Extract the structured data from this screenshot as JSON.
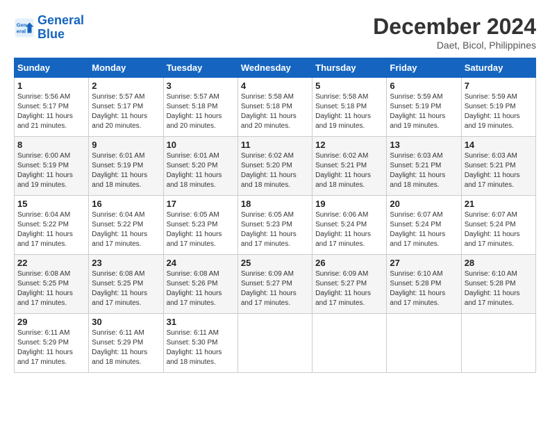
{
  "header": {
    "logo_line1": "General",
    "logo_line2": "Blue",
    "month": "December 2024",
    "location": "Daet, Bicol, Philippines"
  },
  "weekdays": [
    "Sunday",
    "Monday",
    "Tuesday",
    "Wednesday",
    "Thursday",
    "Friday",
    "Saturday"
  ],
  "weeks": [
    [
      {
        "day": "1",
        "sunrise": "Sunrise: 5:56 AM",
        "sunset": "Sunset: 5:17 PM",
        "daylight": "Daylight: 11 hours and 21 minutes."
      },
      {
        "day": "2",
        "sunrise": "Sunrise: 5:57 AM",
        "sunset": "Sunset: 5:17 PM",
        "daylight": "Daylight: 11 hours and 20 minutes."
      },
      {
        "day": "3",
        "sunrise": "Sunrise: 5:57 AM",
        "sunset": "Sunset: 5:18 PM",
        "daylight": "Daylight: 11 hours and 20 minutes."
      },
      {
        "day": "4",
        "sunrise": "Sunrise: 5:58 AM",
        "sunset": "Sunset: 5:18 PM",
        "daylight": "Daylight: 11 hours and 20 minutes."
      },
      {
        "day": "5",
        "sunrise": "Sunrise: 5:58 AM",
        "sunset": "Sunset: 5:18 PM",
        "daylight": "Daylight: 11 hours and 19 minutes."
      },
      {
        "day": "6",
        "sunrise": "Sunrise: 5:59 AM",
        "sunset": "Sunset: 5:19 PM",
        "daylight": "Daylight: 11 hours and 19 minutes."
      },
      {
        "day": "7",
        "sunrise": "Sunrise: 5:59 AM",
        "sunset": "Sunset: 5:19 PM",
        "daylight": "Daylight: 11 hours and 19 minutes."
      }
    ],
    [
      {
        "day": "8",
        "sunrise": "Sunrise: 6:00 AM",
        "sunset": "Sunset: 5:19 PM",
        "daylight": "Daylight: 11 hours and 19 minutes."
      },
      {
        "day": "9",
        "sunrise": "Sunrise: 6:01 AM",
        "sunset": "Sunset: 5:19 PM",
        "daylight": "Daylight: 11 hours and 18 minutes."
      },
      {
        "day": "10",
        "sunrise": "Sunrise: 6:01 AM",
        "sunset": "Sunset: 5:20 PM",
        "daylight": "Daylight: 11 hours and 18 minutes."
      },
      {
        "day": "11",
        "sunrise": "Sunrise: 6:02 AM",
        "sunset": "Sunset: 5:20 PM",
        "daylight": "Daylight: 11 hours and 18 minutes."
      },
      {
        "day": "12",
        "sunrise": "Sunrise: 6:02 AM",
        "sunset": "Sunset: 5:21 PM",
        "daylight": "Daylight: 11 hours and 18 minutes."
      },
      {
        "day": "13",
        "sunrise": "Sunrise: 6:03 AM",
        "sunset": "Sunset: 5:21 PM",
        "daylight": "Daylight: 11 hours and 18 minutes."
      },
      {
        "day": "14",
        "sunrise": "Sunrise: 6:03 AM",
        "sunset": "Sunset: 5:21 PM",
        "daylight": "Daylight: 11 hours and 17 minutes."
      }
    ],
    [
      {
        "day": "15",
        "sunrise": "Sunrise: 6:04 AM",
        "sunset": "Sunset: 5:22 PM",
        "daylight": "Daylight: 11 hours and 17 minutes."
      },
      {
        "day": "16",
        "sunrise": "Sunrise: 6:04 AM",
        "sunset": "Sunset: 5:22 PM",
        "daylight": "Daylight: 11 hours and 17 minutes."
      },
      {
        "day": "17",
        "sunrise": "Sunrise: 6:05 AM",
        "sunset": "Sunset: 5:23 PM",
        "daylight": "Daylight: 11 hours and 17 minutes."
      },
      {
        "day": "18",
        "sunrise": "Sunrise: 6:05 AM",
        "sunset": "Sunset: 5:23 PM",
        "daylight": "Daylight: 11 hours and 17 minutes."
      },
      {
        "day": "19",
        "sunrise": "Sunrise: 6:06 AM",
        "sunset": "Sunset: 5:24 PM",
        "daylight": "Daylight: 11 hours and 17 minutes."
      },
      {
        "day": "20",
        "sunrise": "Sunrise: 6:07 AM",
        "sunset": "Sunset: 5:24 PM",
        "daylight": "Daylight: 11 hours and 17 minutes."
      },
      {
        "day": "21",
        "sunrise": "Sunrise: 6:07 AM",
        "sunset": "Sunset: 5:24 PM",
        "daylight": "Daylight: 11 hours and 17 minutes."
      }
    ],
    [
      {
        "day": "22",
        "sunrise": "Sunrise: 6:08 AM",
        "sunset": "Sunset: 5:25 PM",
        "daylight": "Daylight: 11 hours and 17 minutes."
      },
      {
        "day": "23",
        "sunrise": "Sunrise: 6:08 AM",
        "sunset": "Sunset: 5:25 PM",
        "daylight": "Daylight: 11 hours and 17 minutes."
      },
      {
        "day": "24",
        "sunrise": "Sunrise: 6:08 AM",
        "sunset": "Sunset: 5:26 PM",
        "daylight": "Daylight: 11 hours and 17 minutes."
      },
      {
        "day": "25",
        "sunrise": "Sunrise: 6:09 AM",
        "sunset": "Sunset: 5:27 PM",
        "daylight": "Daylight: 11 hours and 17 minutes."
      },
      {
        "day": "26",
        "sunrise": "Sunrise: 6:09 AM",
        "sunset": "Sunset: 5:27 PM",
        "daylight": "Daylight: 11 hours and 17 minutes."
      },
      {
        "day": "27",
        "sunrise": "Sunrise: 6:10 AM",
        "sunset": "Sunset: 5:28 PM",
        "daylight": "Daylight: 11 hours and 17 minutes."
      },
      {
        "day": "28",
        "sunrise": "Sunrise: 6:10 AM",
        "sunset": "Sunset: 5:28 PM",
        "daylight": "Daylight: 11 hours and 17 minutes."
      }
    ],
    [
      {
        "day": "29",
        "sunrise": "Sunrise: 6:11 AM",
        "sunset": "Sunset: 5:29 PM",
        "daylight": "Daylight: 11 hours and 17 minutes."
      },
      {
        "day": "30",
        "sunrise": "Sunrise: 6:11 AM",
        "sunset": "Sunset: 5:29 PM",
        "daylight": "Daylight: 11 hours and 18 minutes."
      },
      {
        "day": "31",
        "sunrise": "Sunrise: 6:11 AM",
        "sunset": "Sunset: 5:30 PM",
        "daylight": "Daylight: 11 hours and 18 minutes."
      },
      null,
      null,
      null,
      null
    ]
  ]
}
